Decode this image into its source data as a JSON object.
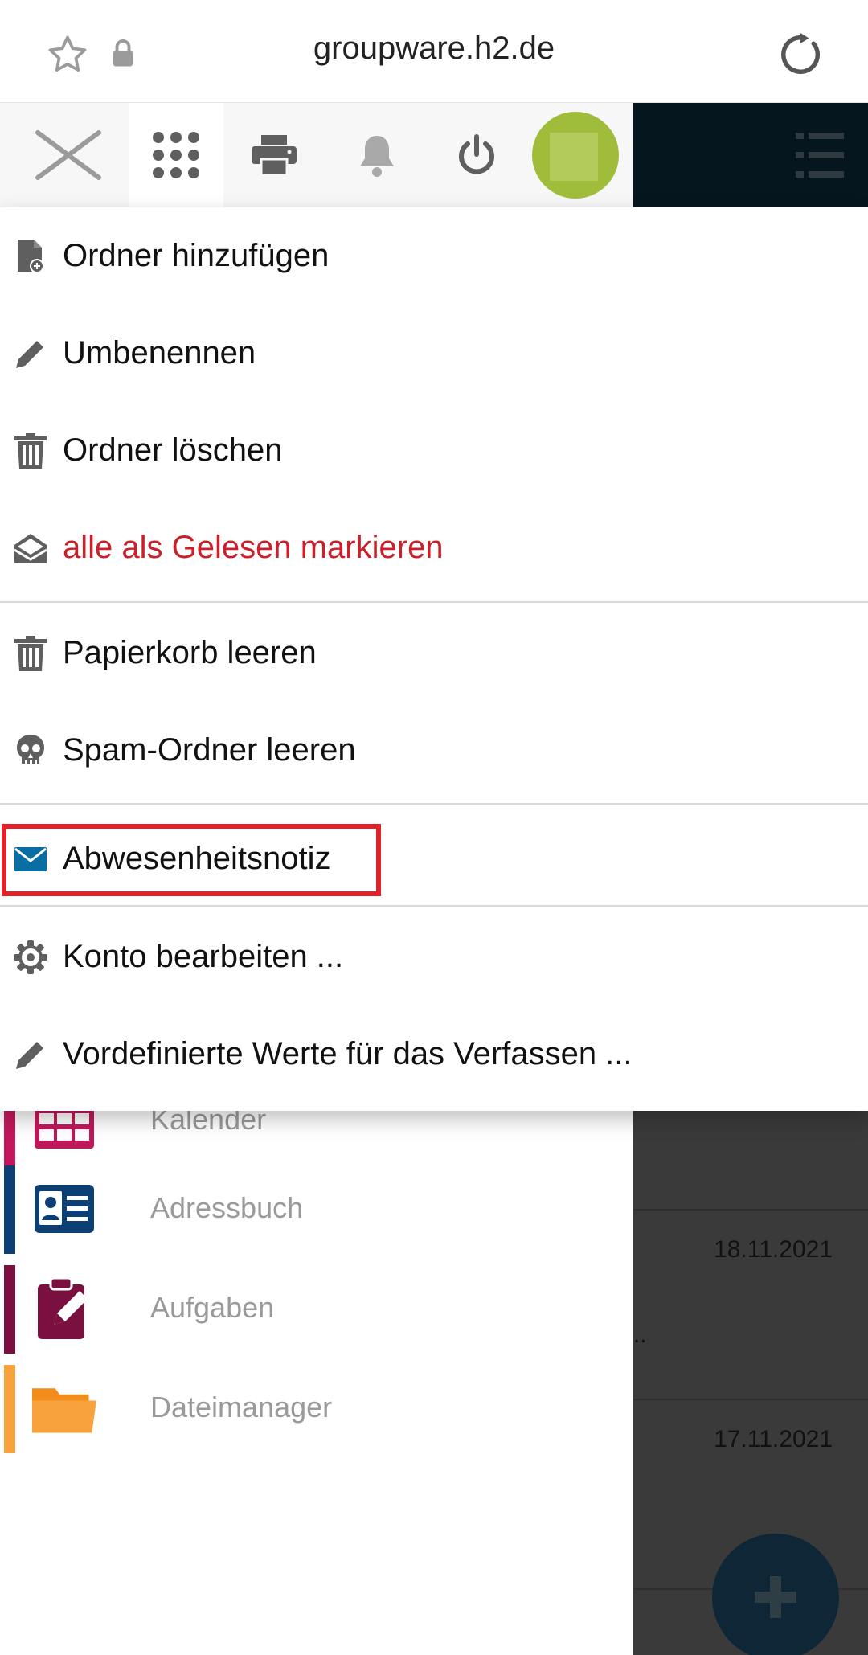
{
  "browser": {
    "url": "groupware.h2.de",
    "star_icon": "star-outline-icon",
    "lock_icon": "lock-icon",
    "reload_icon": "reload-icon"
  },
  "toolbar": {
    "buttons": [
      "close-icon",
      "apps-grid-icon",
      "printer-icon",
      "bell-icon",
      "power-icon",
      "avatar",
      "hamburger-menu-icon"
    ]
  },
  "menu": {
    "items": [
      {
        "label": "Ordner hinzufügen",
        "icon": "file-add-icon"
      },
      {
        "label": "Umbenennen",
        "icon": "pencil-icon"
      },
      {
        "label": "Ordner löschen",
        "icon": "trash-icon"
      },
      {
        "label": "alle als Gelesen markieren",
        "icon": "envelope-open-icon",
        "color": "#c9202a"
      },
      {
        "label": "Papierkorb leeren",
        "icon": "trash-icon"
      },
      {
        "label": "Spam-Ordner leeren",
        "icon": "skull-icon"
      },
      {
        "label": "Abwesenheitsnotiz",
        "icon": "envelope-icon",
        "highlighted": true
      },
      {
        "label": "Konto bearbeiten ...",
        "icon": "gear-icon"
      },
      {
        "label": "Vordefinierte Werte für das Verfassen ...",
        "icon": "pencil-icon"
      }
    ],
    "highlight_color": "#e0222d"
  },
  "sidebar": {
    "apps": [
      {
        "name": "Kalender",
        "color": "#c2185b"
      },
      {
        "name": "Adressbuch",
        "color": "#0d3f74"
      },
      {
        "name": "Aufgaben",
        "color": "#7a1040"
      },
      {
        "name": "Dateimanager",
        "color": "#f7a23c"
      }
    ]
  },
  "mail_list": {
    "dates": [
      "18.11.2021",
      "17.11.2021"
    ],
    "ellipsis": "..",
    "fab_icon": "plus-icon"
  }
}
